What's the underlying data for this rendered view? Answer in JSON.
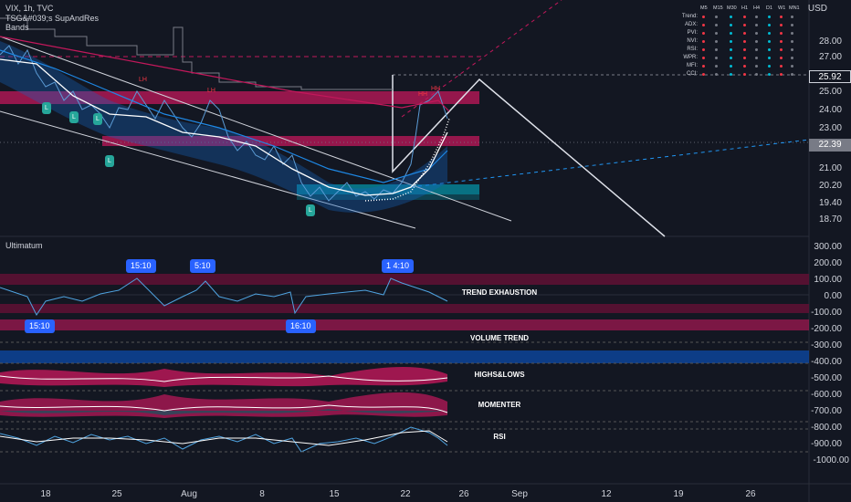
{
  "symbol": {
    "title": "VIX, 1h, TVC",
    "script": "TSG&#039;s SupAndRes",
    "bands": "Bands",
    "currency": "USD"
  },
  "price_axis": [
    "28.00",
    "27.00",
    "25.92",
    "25.00",
    "24.00",
    "23.00",
    "22.39",
    "21.00",
    "20.20",
    "19.40",
    "18.70"
  ],
  "price_badges": {
    "last": "25.92",
    "current": "22.39"
  },
  "oscillator": {
    "name": "Ultimatum",
    "axis": [
      "300.00",
      "200.00",
      "100.00",
      "0.00",
      "-100.00",
      "-200.00",
      "-300.00",
      "-400.00",
      "-500.00",
      "-600.00",
      "-700.00",
      "-800.00",
      "-900.00",
      "-1000.00"
    ],
    "tags": [
      "15:10",
      "5:10",
      "1 4:10",
      "15:10",
      "16:10"
    ],
    "panels": [
      "TREND EXHAUSTION",
      "VOLUME TREND",
      "HIGHS&LOWS",
      "MOMENTER",
      "RSI"
    ]
  },
  "time_axis": [
    "18",
    "25",
    "Aug",
    "8",
    "15",
    "22",
    "26",
    "Sep",
    "12",
    "19",
    "26"
  ],
  "markers": {
    "hh": [
      "HH",
      "HH"
    ],
    "lh": [
      "LH",
      "LH"
    ],
    "l": [
      "L",
      "L",
      "L",
      "L",
      "L"
    ]
  },
  "dashboard": {
    "columns": [
      "M5",
      "M15",
      "M30",
      "H1",
      "H4",
      "D1",
      "W1",
      "MN1"
    ],
    "rows": [
      "Trend:",
      "ADX:",
      "PVI:",
      "NVI:",
      "RSI:",
      "WPR:",
      "MFI:",
      "CCI:"
    ]
  },
  "colors": {
    "background": "#131722",
    "bear": "#c2185b",
    "bull": "#00bcd4",
    "accent_blue": "#2962ff",
    "text": "#d1d4dc"
  }
}
